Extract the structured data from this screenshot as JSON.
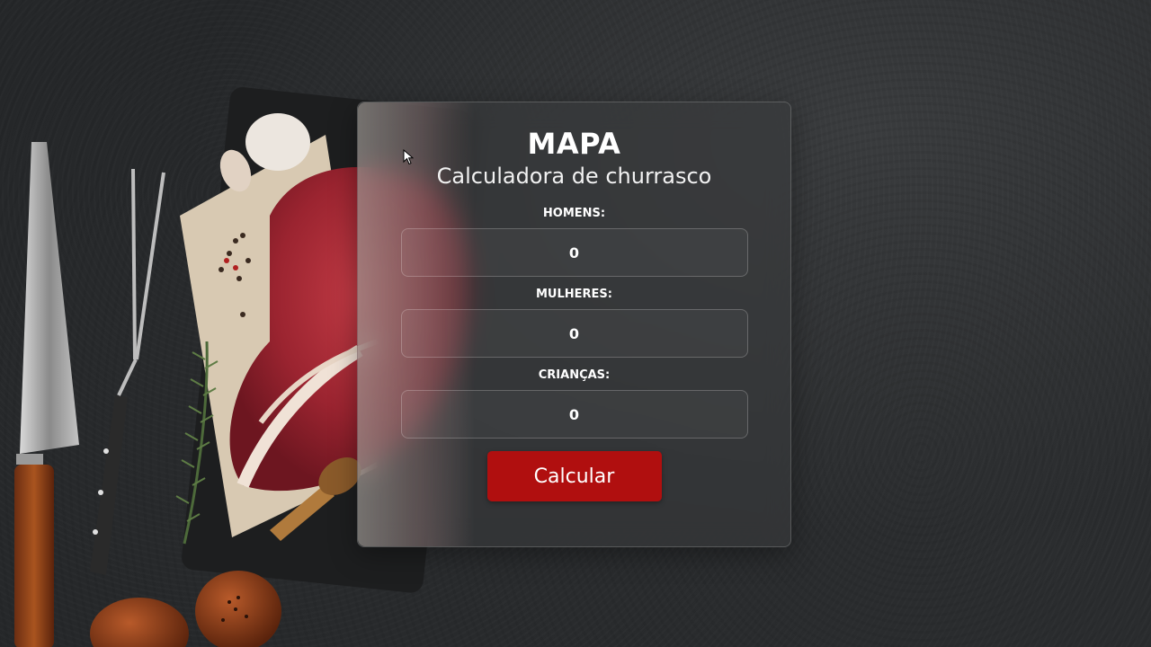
{
  "card": {
    "title": "MAPA",
    "subtitle": "Calculadora de churrasco"
  },
  "fields": [
    {
      "label": "HOMENS:",
      "value": "0"
    },
    {
      "label": "MULHERES:",
      "value": "0"
    },
    {
      "label": "CRIANÇAS:",
      "value": "0"
    }
  ],
  "actions": {
    "calculate_label": "Calcular"
  },
  "colors": {
    "background": "#252729",
    "button": "#b00f0f",
    "text": "#ffffff"
  },
  "background_image": "barbecue-still-life-knife-fork-meat-garlic-rosemary"
}
